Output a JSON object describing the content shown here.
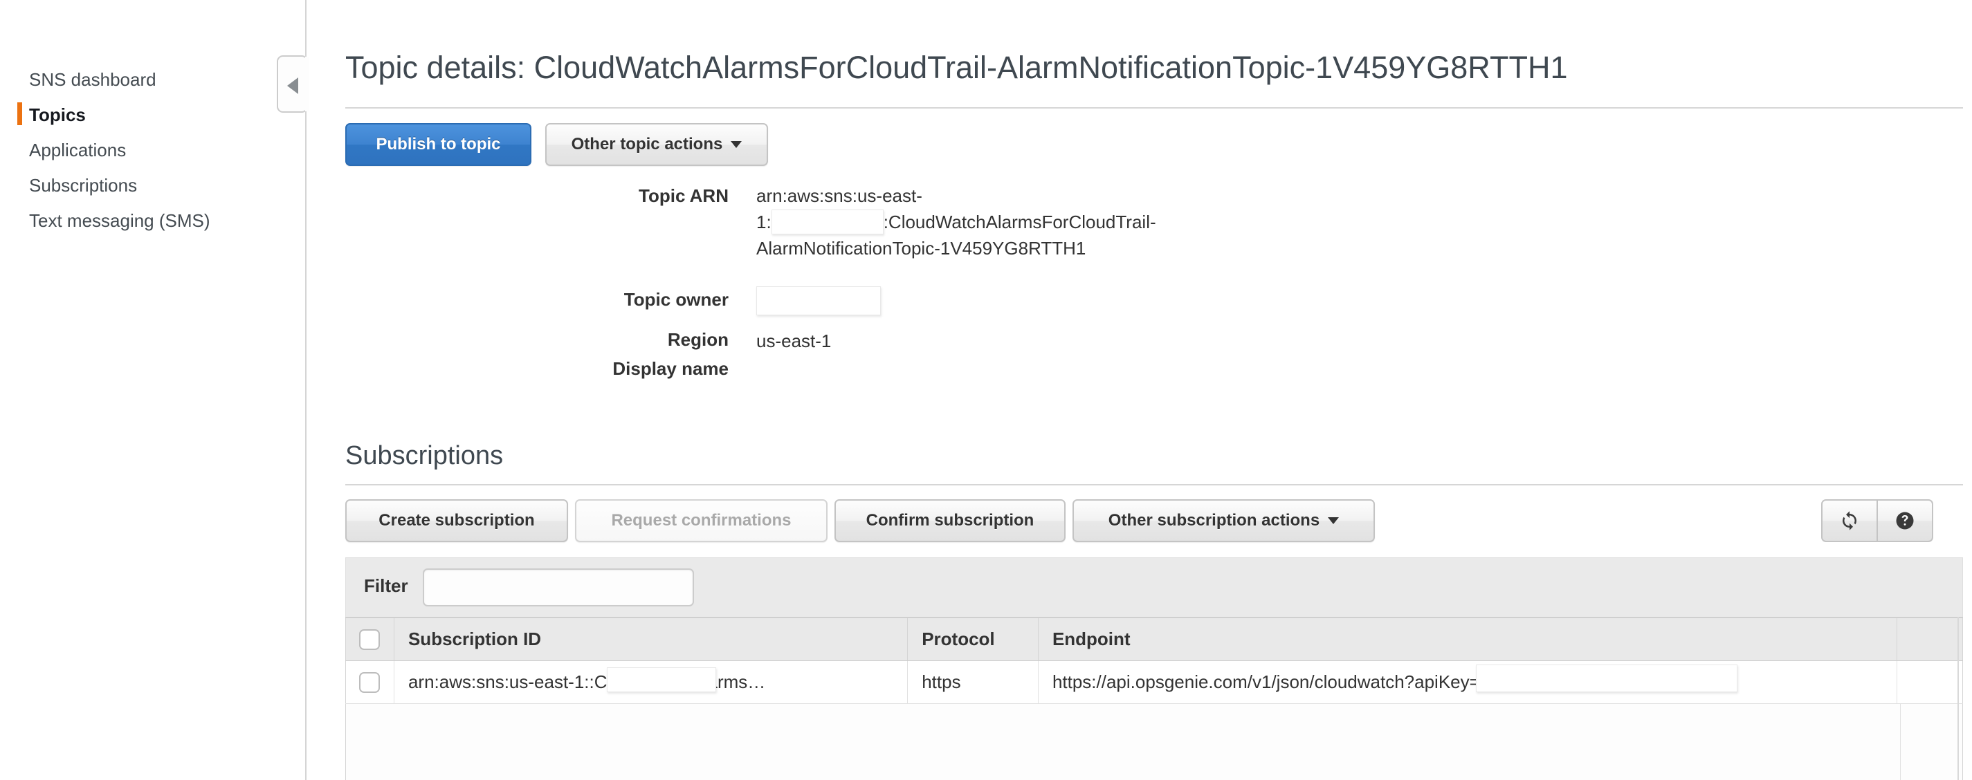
{
  "sidebar": {
    "items": [
      {
        "label": "SNS dashboard",
        "active": false
      },
      {
        "label": "Topics",
        "active": true
      },
      {
        "label": "Applications",
        "active": false
      },
      {
        "label": "Subscriptions",
        "active": false
      },
      {
        "label": "Text messaging (SMS)",
        "active": false
      }
    ],
    "collapse_icon": "chevron-left-icon",
    "active_accent_color": "#ec7211"
  },
  "header": {
    "title": "Topic details: CloudWatchAlarmsForCloudTrail-AlarmNotificationTopic-1V459YG8RTTH1"
  },
  "topic_actions": {
    "publish_label": "Publish to topic",
    "other_label": "Other topic actions",
    "primary_color": "#3077c4"
  },
  "topic_details": {
    "arn_label": "Topic ARN",
    "arn_prefix": "arn:aws:sns:us-east-",
    "arn_line2_prefix": "1:",
    "arn_line2_suffix": ":CloudWatchAlarmsForCloudTrail-",
    "arn_line3": "AlarmNotificationTopic-1V459YG8RTTH1",
    "owner_label": "Topic owner",
    "owner_value": "",
    "region_label": "Region",
    "region_value": "us-east-1",
    "display_name_label": "Display name",
    "display_name_value": ""
  },
  "subscriptions": {
    "section_title": "Subscriptions",
    "buttons": {
      "create": "Create subscription",
      "request_confirmations": "Request confirmations",
      "confirm": "Confirm subscription",
      "other": "Other subscription actions"
    },
    "icon_buttons": {
      "refresh": "refresh-icon",
      "help": "help-icon"
    },
    "filter": {
      "label": "Filter",
      "value": "",
      "placeholder": ""
    },
    "table": {
      "columns": [
        "Subscription ID",
        "Protocol",
        "Endpoint"
      ],
      "rows": [
        {
          "subscription_id_prefix": "arn:aws:sns:us-east-1:",
          "subscription_id_suffix": ":CloudWatchAlarms…",
          "protocol": "https",
          "endpoint_prefix": "https://api.opsgenie.com/v1/json/cloudwatch?apiKey=",
          "endpoint_suffix": "…"
        }
      ]
    }
  }
}
